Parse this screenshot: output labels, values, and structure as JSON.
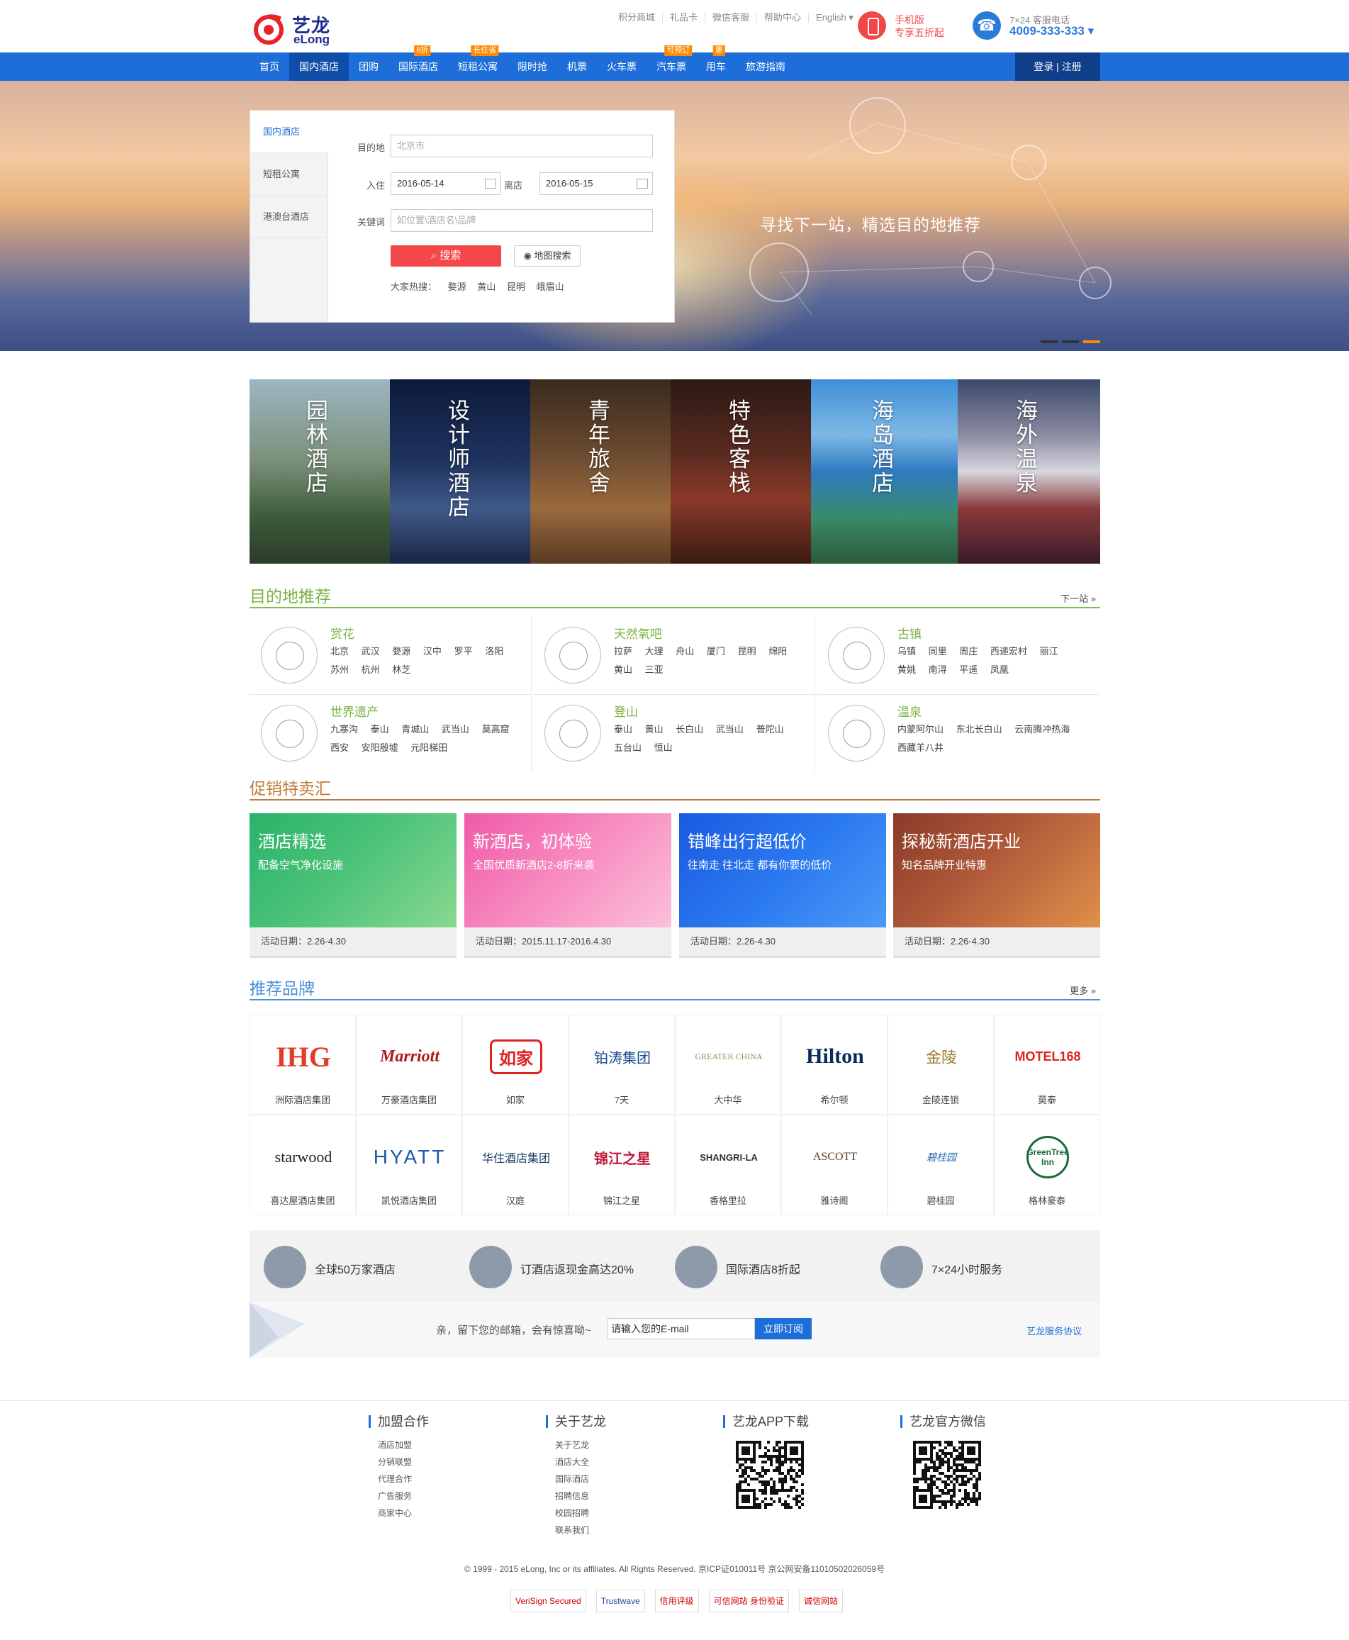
{
  "header": {
    "logo_cn": "艺龙",
    "logo_en": "eLong",
    "top_links": [
      "积分商城",
      "礼品卡",
      "微信客服",
      "帮助中心",
      "English ▾"
    ],
    "mobile_line1": "手机版",
    "mobile_line2": "专享五折起",
    "phone_label": "7×24 客服电话",
    "phone_number": "4009-333-333 ▾"
  },
  "nav": {
    "items": [
      {
        "label": "首页",
        "badge": ""
      },
      {
        "label": "国内酒店",
        "badge": ""
      },
      {
        "label": "团购",
        "badge": ""
      },
      {
        "label": "国际酒店",
        "badge": "8折"
      },
      {
        "label": "短租公寓",
        "badge": "长住省"
      },
      {
        "label": "限时抢",
        "badge": ""
      },
      {
        "label": "机票",
        "badge": ""
      },
      {
        "label": "火车票",
        "badge": ""
      },
      {
        "label": "汽车票",
        "badge": "可预订"
      },
      {
        "label": "用车",
        "badge": "惠"
      },
      {
        "label": "旅游指南",
        "badge": ""
      }
    ],
    "login": "登录 | 注册",
    "active_index": 1
  },
  "hero": {
    "slogan": "寻找下一站，精选目的地推荐",
    "tabs": [
      "国内酒店",
      "短租公寓",
      "港澳台酒店"
    ],
    "destination_label": "目的地",
    "destination_placeholder": "北京市",
    "checkin_label": "入住",
    "checkin_value": "2016-05-14",
    "checkout_label": "离店",
    "checkout_value": "2016-05-15",
    "keyword_label": "关键词",
    "keyword_placeholder": "如位置\\酒店名\\品牌",
    "search_button": "搜索",
    "map_button": "地图搜索",
    "hot_label": "大家热搜：",
    "hot_items": [
      "婺源",
      "黄山",
      "昆明",
      "峨眉山"
    ]
  },
  "themes": [
    "园林酒店",
    "设计师酒店",
    "青年旅舍",
    "特色客栈",
    "海岛酒店",
    "海外温泉"
  ],
  "destinations": {
    "title": "目的地推荐",
    "more": "下一站 »",
    "groups": [
      {
        "name": "赏花",
        "cities": [
          "北京",
          "武汉",
          "婺源",
          "汉中",
          "罗平",
          "洛阳",
          "苏州",
          "杭州",
          "林芝"
        ]
      },
      {
        "name": "天然氧吧",
        "cities": [
          "拉萨",
          "大理",
          "舟山",
          "厦门",
          "昆明",
          "绵阳",
          "黄山",
          "三亚"
        ]
      },
      {
        "name": "古镇",
        "cities": [
          "乌镇",
          "同里",
          "周庄",
          "西递宏村",
          "丽江",
          "黄姚",
          "南浔",
          "平遥",
          "凤凰"
        ]
      },
      {
        "name": "世界遗产",
        "cities": [
          "九寨沟",
          "泰山",
          "青城山",
          "武当山",
          "莫高窟",
          "西安",
          "安阳殷墟",
          "元阳梯田"
        ]
      },
      {
        "name": "登山",
        "cities": [
          "泰山",
          "黄山",
          "长白山",
          "武当山",
          "普陀山",
          "五台山",
          "恒山"
        ]
      },
      {
        "name": "温泉",
        "cities": [
          "内蒙阿尔山",
          "东北长白山",
          "云南腾冲热海",
          "西藏羊八井"
        ]
      }
    ]
  },
  "promos": {
    "title": "促销特卖汇",
    "items": [
      {
        "title": "酒店精选",
        "subtitle": "配备空气净化设施",
        "date": "活动日期：2.26-4.30"
      },
      {
        "title": "新酒店，初体验",
        "subtitle": "全国优质新酒店2-8折来袭",
        "date": "活动日期：2015.11.17-2016.4.30"
      },
      {
        "title": "错峰出行超低价",
        "subtitle": "往南走 往北走 都有你要的低价",
        "date": "活动日期：2.26-4.30"
      },
      {
        "title": "探秘新酒店开业",
        "subtitle": "知名品牌开业特惠",
        "date": "活动日期：2.26-4.30"
      }
    ]
  },
  "brands": {
    "title": "推荐品牌",
    "more": "更多 »",
    "items": [
      {
        "logo": "IHG",
        "name": "洲际酒店集团"
      },
      {
        "logo": "Marriott",
        "name": "万豪酒店集团"
      },
      {
        "logo": "如家",
        "name": "如家"
      },
      {
        "logo": "铂涛集团",
        "name": "7天"
      },
      {
        "logo": "GREATER CHINA",
        "name": "大中华"
      },
      {
        "logo": "Hilton",
        "name": "希尔顿"
      },
      {
        "logo": "金陵",
        "name": "金陵连锁"
      },
      {
        "logo": "MOTEL168",
        "name": "莫泰"
      },
      {
        "logo": "starwood",
        "name": "喜达屋酒店集团"
      },
      {
        "logo": "HYATT",
        "name": "凯悦酒店集团"
      },
      {
        "logo": "华住酒店集团",
        "name": "汉庭"
      },
      {
        "logo": "锦江之星",
        "name": "锦江之星"
      },
      {
        "logo": "SHANGRI-LA",
        "name": "香格里拉"
      },
      {
        "logo": "ASCOTT",
        "name": "雅诗阁"
      },
      {
        "logo": "碧桂园",
        "name": "碧桂园"
      },
      {
        "logo": "GreenTree Inn",
        "name": "格林豪泰"
      }
    ]
  },
  "features": [
    {
      "text": "全球50万家酒店"
    },
    {
      "text": "订酒店返现金高达20%"
    },
    {
      "text": "国际酒店8折起"
    },
    {
      "text": "7×24小时服务"
    }
  ],
  "subscribe": {
    "message": "亲，留下您的邮箱，会有惊喜呦~",
    "email_value": "请输入您的E-mail",
    "button": "立即订阅",
    "agreement": "艺龙服务协议"
  },
  "footer": {
    "columns": [
      {
        "title": "加盟合作",
        "links": [
          "酒店加盟",
          "分销联盟",
          "代理合作",
          "广告服务",
          "商家中心"
        ]
      },
      {
        "title": "关于艺龙",
        "links": [
          "关于艺龙",
          "酒店大全",
          "国际酒店",
          "招聘信息",
          "校园招聘",
          "联系我们"
        ]
      },
      {
        "title": "艺龙APP下载",
        "links": []
      },
      {
        "title": "艺龙官方微信",
        "links": []
      }
    ],
    "copyright": "© 1999 - 2015 eLong, Inc or its affiliates. All Rights Reserved. 京ICP证010011号 京公网安备11010502026059号",
    "certs": [
      "VeriSign Secured",
      "Trustwave",
      "信用评级",
      "可信网站 身份验证",
      "诚信网站"
    ]
  }
}
